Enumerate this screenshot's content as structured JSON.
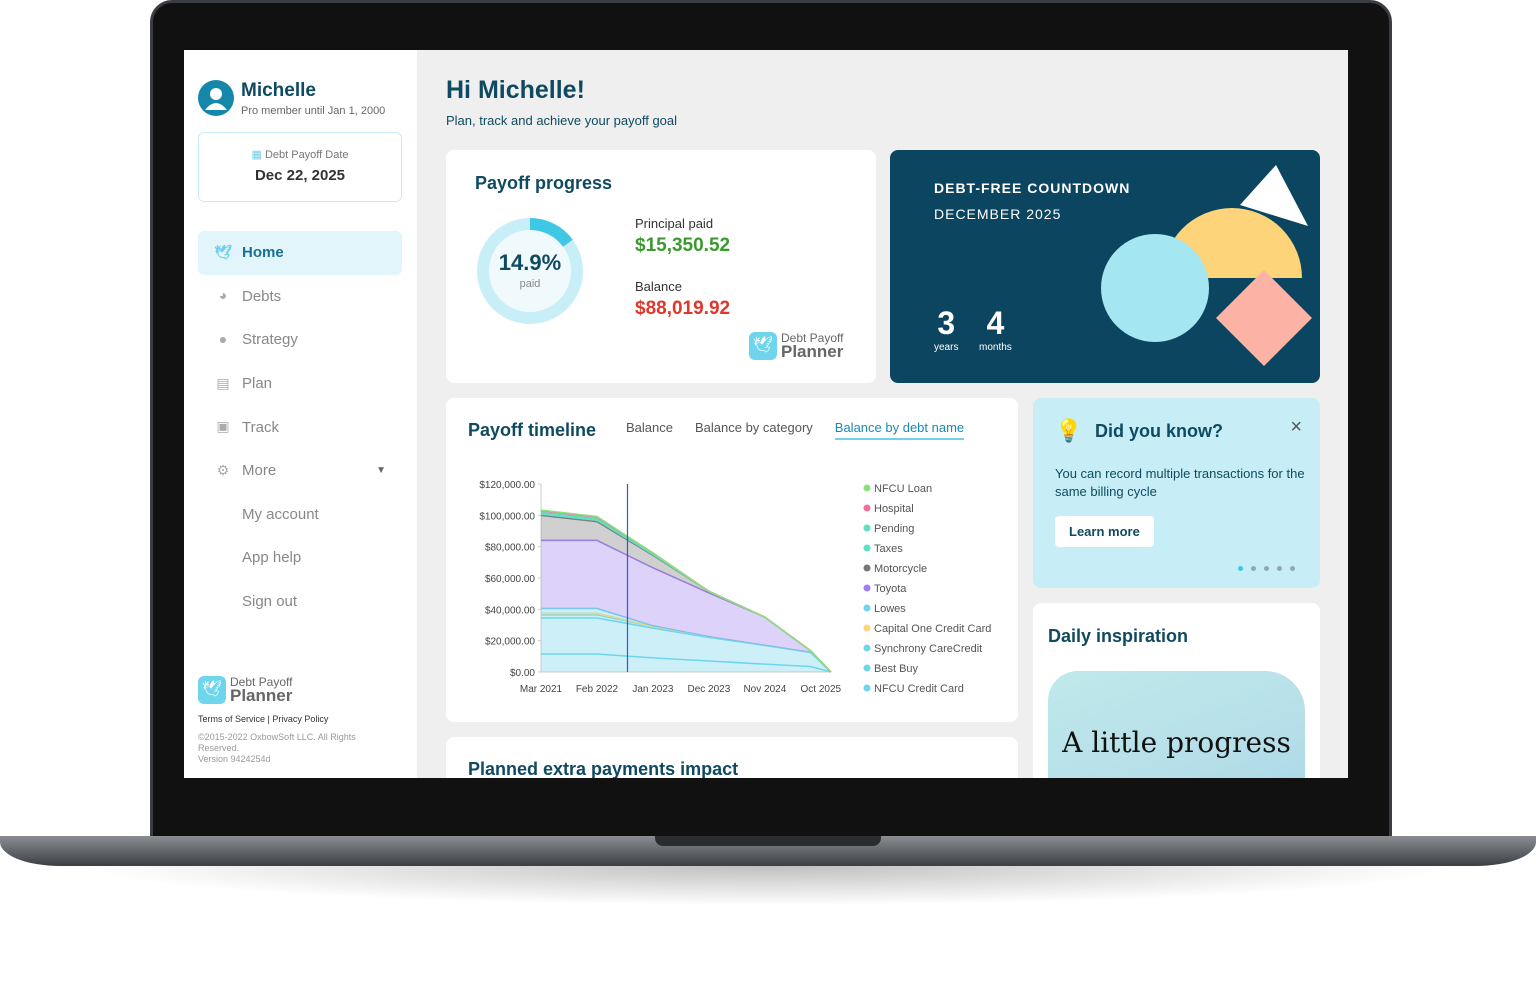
{
  "user": {
    "name": "Michelle",
    "membership": "Pro member until Jan 1, 2000"
  },
  "payoff_date": {
    "label": "Debt Payoff Date",
    "value": "Dec 22, 2025"
  },
  "sidebar": {
    "items": [
      {
        "label": "Home",
        "icon": "dove-icon",
        "active": true
      },
      {
        "label": "Debts",
        "icon": "pie-chart-icon"
      },
      {
        "label": "Strategy",
        "icon": "lightbulb-icon"
      },
      {
        "label": "Plan",
        "icon": "clipboard-icon"
      },
      {
        "label": "Track",
        "icon": "calendar-check-icon"
      },
      {
        "label": "More",
        "icon": "gears-icon"
      }
    ],
    "subitems": [
      "My account",
      "App help",
      "Sign out"
    ]
  },
  "brand": {
    "line1": "Debt Payoff",
    "line2": "Planner"
  },
  "footer": {
    "terms": "Terms of Service",
    "sep": "|",
    "privacy": "Privacy Policy",
    "copyright": "©2015-2022 OxbowSoft LLC. All Rights Reserved.",
    "version": "Version 9424254d"
  },
  "header": {
    "greeting": "Hi Michelle!",
    "subtitle": "Plan, track and achieve your payoff goal"
  },
  "progress": {
    "title": "Payoff progress",
    "percent": "14.9%",
    "percent_value": 14.9,
    "percent_label": "paid",
    "principal_label": "Principal paid",
    "principal": "$15,350.52",
    "balance_label": "Balance",
    "balance": "$88,019.92"
  },
  "countdown": {
    "title": "DEBT-FREE COUNTDOWN",
    "month": "DECEMBER 2025",
    "years": "3",
    "years_label": "years",
    "months": "4",
    "months_label": "months"
  },
  "timeline": {
    "title": "Payoff timeline",
    "tabs": [
      "Balance",
      "Balance by category",
      "Balance by debt name"
    ],
    "active_tab": 2
  },
  "tip": {
    "title": "Did you know?",
    "text": "You can record multiple transactions for the same billing cycle",
    "button": "Learn more",
    "pages": 5,
    "active_page": 0
  },
  "inspiration": {
    "title": "Daily inspiration",
    "quote": "A little progress"
  },
  "extra": {
    "title": "Planned extra payments impact"
  },
  "chart_data": {
    "type": "area",
    "stacked": true,
    "x": [
      "2021-03",
      "2022-02",
      "2023-01",
      "2023-12",
      "2024-11",
      "2025-08",
      "2025-12"
    ],
    "x_ticks": [
      "Mar 2021",
      "Feb 2022",
      "Jan 2023",
      "Dec 2023",
      "Nov 2024",
      "Oct 2025"
    ],
    "y_ticks": [
      "$0.00",
      "$20,000.00",
      "$40,000.00",
      "$60,000.00",
      "$80,000.00",
      "$100,000.00",
      "$120,000.00"
    ],
    "ylim": [
      0,
      120000
    ],
    "current_date_marker": "2022-08",
    "legend_position": "right",
    "series": [
      {
        "name": "NFCU Credit Card",
        "color": "#6fd5ec",
        "values": [
          11500,
          11500,
          9000,
          7000,
          5000,
          3500,
          0
        ]
      },
      {
        "name": "Best Buy",
        "color": "#6fd5ec",
        "values": [
          23000,
          23000,
          19000,
          15000,
          12000,
          9000,
          0
        ]
      },
      {
        "name": "Synchrony CareCredit",
        "color": "#6fd5ec",
        "values": [
          2000,
          2000,
          1000,
          500,
          0,
          0,
          0
        ]
      },
      {
        "name": "Capital One Credit Card",
        "color": "#f9d67a",
        "values": [
          1000,
          1000,
          0,
          0,
          0,
          0,
          0
        ]
      },
      {
        "name": "Lowes",
        "color": "#6fd5ec",
        "values": [
          3000,
          3000,
          500,
          0,
          0,
          0,
          0
        ]
      },
      {
        "name": "Toyota",
        "color": "#9d7ff0",
        "values": [
          43500,
          43500,
          37000,
          28000,
          18000,
          1000,
          0
        ]
      },
      {
        "name": "Motorcycle",
        "color": "#777777",
        "values": [
          16000,
          12000,
          8000,
          1000,
          0,
          0,
          0
        ]
      },
      {
        "name": "Taxes",
        "color": "#5de0c0",
        "values": [
          1000,
          1000,
          500,
          0,
          0,
          0,
          0
        ]
      },
      {
        "name": "Pending",
        "color": "#5de0c0",
        "values": [
          1000,
          1000,
          500,
          0,
          0,
          0,
          0
        ]
      },
      {
        "name": "Hospital",
        "color": "#ee6fa0",
        "values": [
          1000,
          1000,
          500,
          0,
          0,
          0,
          0
        ]
      },
      {
        "name": "NFCU Loan",
        "color": "#8ee07a",
        "values": [
          300,
          300,
          0,
          0,
          0,
          0,
          0
        ]
      }
    ],
    "legend_order": [
      "NFCU Loan",
      "Hospital",
      "Pending",
      "Taxes",
      "Motorcycle",
      "Toyota",
      "Lowes",
      "Capital One Credit Card",
      "Synchrony CareCredit",
      "Best Buy",
      "NFCU Credit Card"
    ]
  }
}
